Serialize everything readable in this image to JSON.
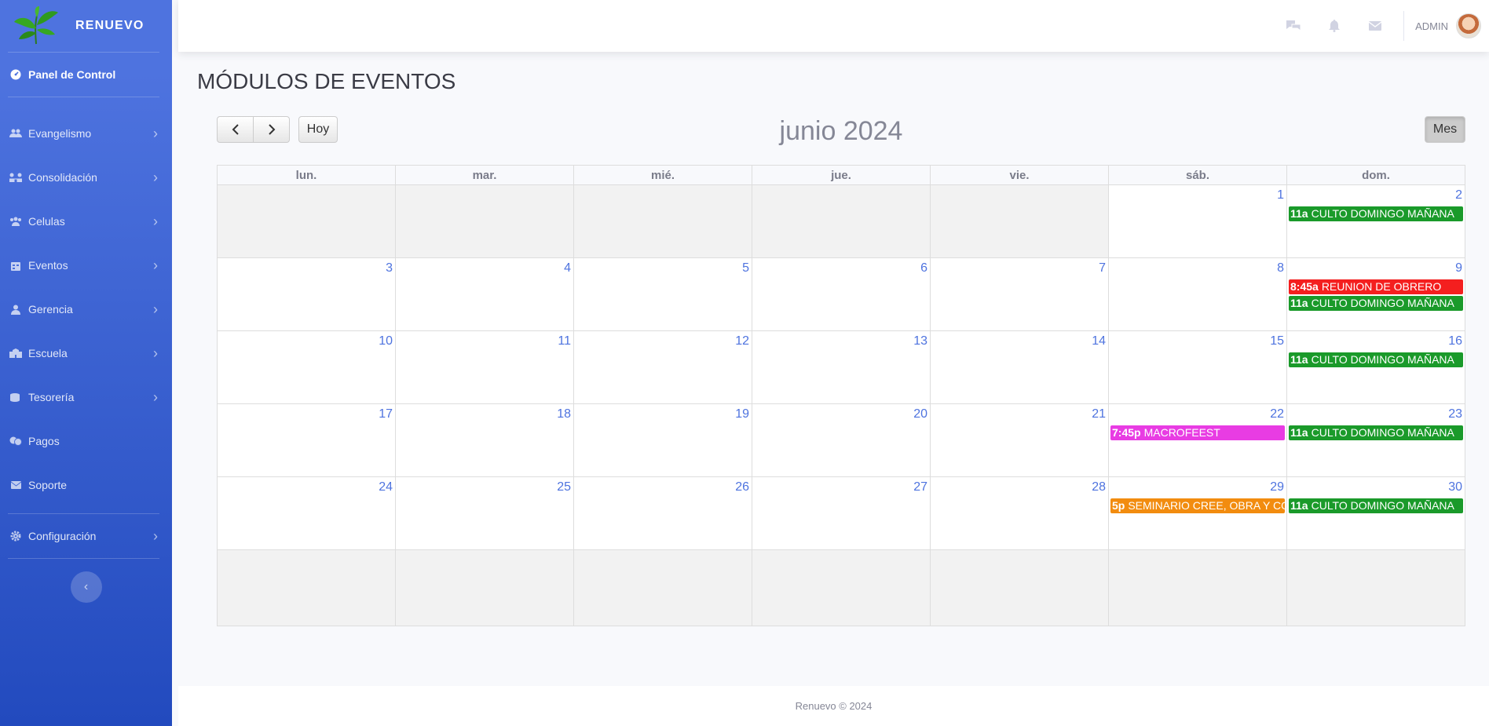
{
  "brand": {
    "name": "RENUEVO"
  },
  "sidebar": {
    "dashboard": {
      "label": "Panel de Control",
      "icon": "dashboard-icon"
    },
    "items": [
      {
        "label": "Evangelismo",
        "icon": "users-icon",
        "submenu": true
      },
      {
        "label": "Consolidación",
        "icon": "connection-icon",
        "submenu": true
      },
      {
        "label": "Celulas",
        "icon": "group-icon",
        "submenu": true
      },
      {
        "label": "Eventos",
        "icon": "calendar-icon",
        "submenu": true
      },
      {
        "label": "Gerencia",
        "icon": "user-tie-icon",
        "submenu": true
      },
      {
        "label": "Escuela",
        "icon": "school-icon",
        "submenu": true
      },
      {
        "label": "Tesorería",
        "icon": "coins-icon",
        "submenu": true
      },
      {
        "label": "Pagos",
        "icon": "money-icon",
        "submenu": false
      },
      {
        "label": "Soporte",
        "icon": "envelope-icon",
        "submenu": false
      }
    ],
    "config": {
      "label": "Configuración",
      "icon": "gear-icon"
    },
    "toggle_icon": "chevron-left-icon"
  },
  "topbar": {
    "icons": [
      "chat-icon",
      "bell-icon",
      "envelope-icon"
    ],
    "user": "ADMIN"
  },
  "page": {
    "title": "MÓDULOS DE EVENTOS"
  },
  "calendar": {
    "title": "junio 2024",
    "today_label": "Hoy",
    "month_label": "Mes",
    "weekdays": [
      "lun.",
      "mar.",
      "mié.",
      "jue.",
      "vie.",
      "sáb.",
      "dom."
    ],
    "weeks": [
      [
        {
          "d": ""
        },
        {
          "d": ""
        },
        {
          "d": ""
        },
        {
          "d": ""
        },
        {
          "d": ""
        },
        {
          "d": "1"
        },
        {
          "d": "2",
          "events": [
            {
              "time": "11a",
              "title": "CULTO DOMINGO MAÑANA",
              "color": "#1a9a2a"
            }
          ]
        }
      ],
      [
        {
          "d": "3"
        },
        {
          "d": "4"
        },
        {
          "d": "5"
        },
        {
          "d": "6"
        },
        {
          "d": "7"
        },
        {
          "d": "8"
        },
        {
          "d": "9",
          "events": [
            {
              "time": "8:45a",
              "title": "REUNION DE OBRERO",
              "color": "#f41f1f"
            },
            {
              "time": "11a",
              "title": "CULTO DOMINGO MAÑANA",
              "color": "#1a9a2a"
            }
          ]
        }
      ],
      [
        {
          "d": "10"
        },
        {
          "d": "11"
        },
        {
          "d": "12"
        },
        {
          "d": "13"
        },
        {
          "d": "14"
        },
        {
          "d": "15"
        },
        {
          "d": "16",
          "events": [
            {
              "time": "11a",
              "title": "CULTO DOMINGO MAÑANA",
              "color": "#1a9a2a"
            }
          ]
        }
      ],
      [
        {
          "d": "17"
        },
        {
          "d": "18"
        },
        {
          "d": "19"
        },
        {
          "d": "20"
        },
        {
          "d": "21"
        },
        {
          "d": "22",
          "events": [
            {
              "time": "7:45p",
              "title": "MACROFEEST",
              "color": "#e83ce3"
            }
          ]
        },
        {
          "d": "23",
          "events": [
            {
              "time": "11a",
              "title": "CULTO DOMINGO MAÑANA",
              "color": "#1a9a2a"
            }
          ]
        }
      ],
      [
        {
          "d": "24"
        },
        {
          "d": "25"
        },
        {
          "d": "26"
        },
        {
          "d": "27"
        },
        {
          "d": "28"
        },
        {
          "d": "29",
          "events": [
            {
              "time": "5p",
              "title": "SEMINARIO CREE, OBRA Y COI",
              "color": "#f28c0f"
            }
          ]
        },
        {
          "d": "30",
          "events": [
            {
              "time": "11a",
              "title": "CULTO DOMINGO MAÑANA",
              "color": "#1a9a2a"
            }
          ]
        }
      ],
      [
        {
          "d": ""
        },
        {
          "d": ""
        },
        {
          "d": ""
        },
        {
          "d": ""
        },
        {
          "d": ""
        },
        {
          "d": ""
        },
        {
          "d": ""
        }
      ]
    ]
  },
  "footer": {
    "text": "Renuevo © 2024"
  }
}
